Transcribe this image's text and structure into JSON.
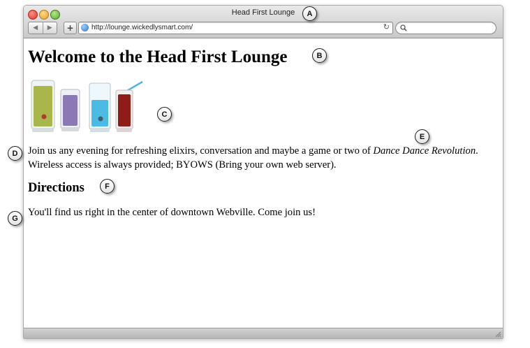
{
  "browser": {
    "window_title": "Head First Lounge",
    "url": "http://lounge.wickedlysmart.com/",
    "back_icon": "◀",
    "forward_icon": "▶",
    "add_bookmark_label": "+",
    "reload_icon": "↻",
    "search_placeholder": ""
  },
  "page": {
    "title": "Welcome to the Head First Lounge",
    "intro_text": "Join us any evening for refreshing elixirs, conversation and maybe a game or two of ",
    "intro_emphasis": "Dance Dance Revolution",
    "intro_text_after": ". Wireless access is always provided; BYOWS (Bring your own web server).",
    "directions_heading": "Directions",
    "directions_text": "You'll find us right in the center of downtown Webville. Come join us!",
    "drink_colors": [
      "#a8b64a",
      "#8a79b4",
      "#4bbbe6",
      "#8d1d16"
    ]
  },
  "callouts": [
    "A",
    "B",
    "C",
    "D",
    "E",
    "F",
    "G"
  ]
}
